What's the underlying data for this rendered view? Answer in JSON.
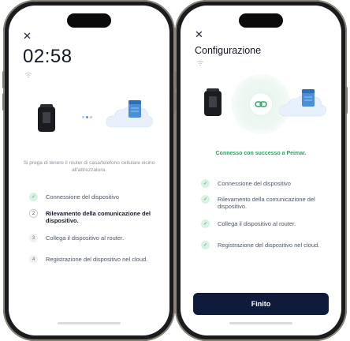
{
  "left_screen": {
    "close_icon": "close-icon",
    "timer": "02:58",
    "hint": "Si prega di tenere il router di casa/telefono cellulare vicino all'attrezzatura.",
    "steps": [
      {
        "index": "1",
        "label": "Connessione del dispositivo",
        "state": "done"
      },
      {
        "index": "2",
        "label": "Rilevamento della comunicazione del dispositivo.",
        "state": "active"
      },
      {
        "index": "3",
        "label": "Collega il dispositivo al router.",
        "state": "pending"
      },
      {
        "index": "4",
        "label": "Registrazione del dispositivo nel cloud.",
        "state": "pending"
      }
    ]
  },
  "right_screen": {
    "close_icon": "close-icon",
    "title": "Configurazione",
    "success": "Connesso con successo a Peimar.",
    "steps": [
      {
        "label": "Connessione del dispositivo",
        "state": "done"
      },
      {
        "label": "Rilevamento della comunicazione del dispositivo.",
        "state": "done"
      },
      {
        "label": "Collega il dispositivo al router.",
        "state": "done"
      },
      {
        "label": "Registrazione del dispositivo nel cloud.",
        "state": "done"
      }
    ],
    "finish_button": "Finito"
  },
  "colors": {
    "accent_green": "#2f9e62",
    "primary_dark": "#0e1b3a",
    "cloud_blue": "#4a90d9"
  }
}
